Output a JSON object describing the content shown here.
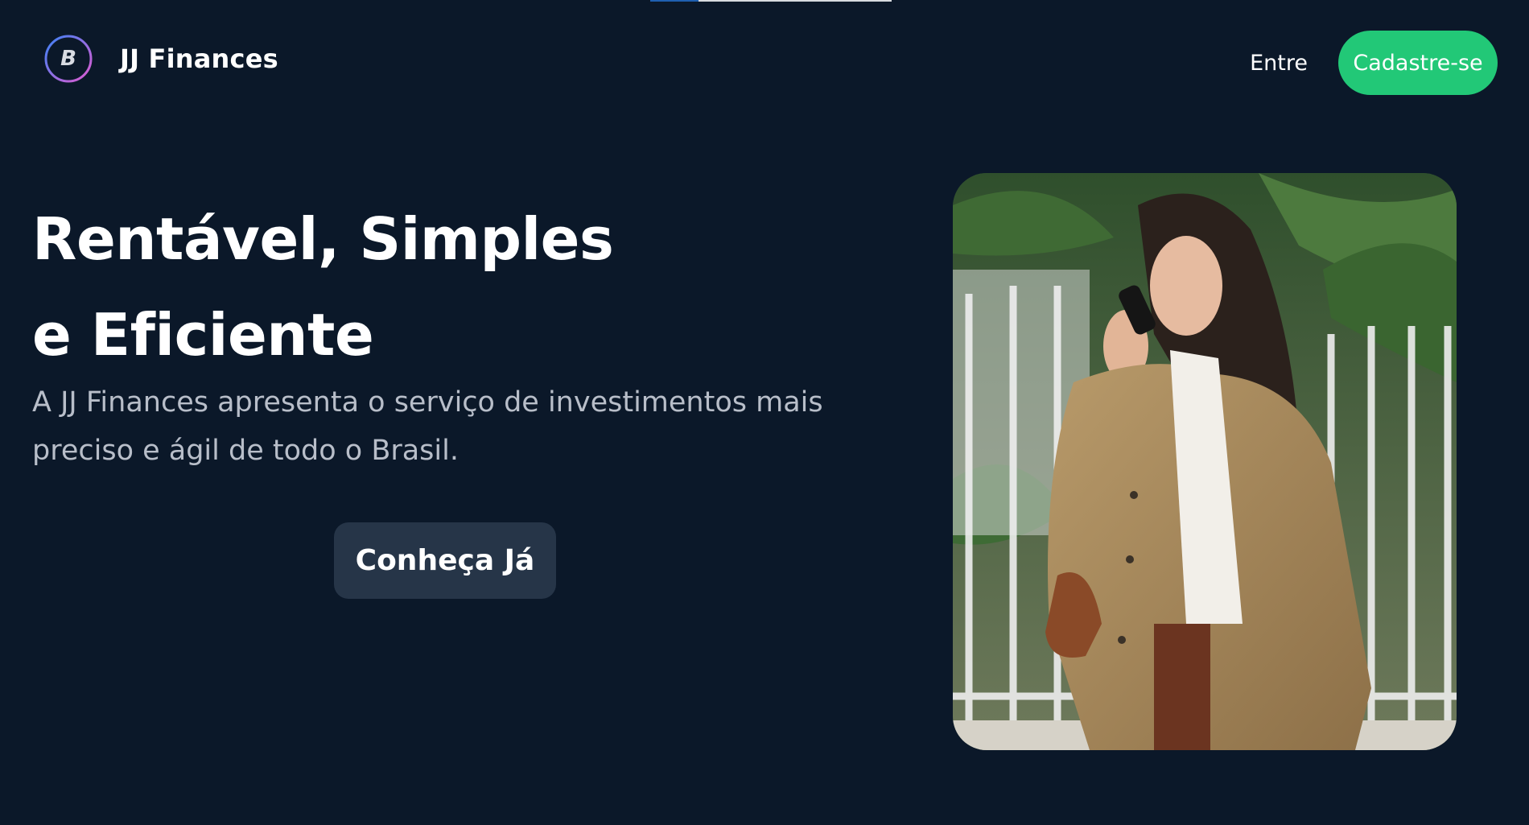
{
  "top_strip": {
    "colors": [
      "#1f5fb0",
      "#d8dbe0"
    ]
  },
  "header": {
    "logo_icon": "bitcoin-icon",
    "logo_glyph": "B",
    "brand": "JJ Finances",
    "login_label": "Entre",
    "signup_label": "Cadastre-se"
  },
  "hero": {
    "title_line1": "Rentável, Simples",
    "title_line2": "e Eficiente",
    "description": "A JJ Finances apresenta o serviço de investimentos mais preciso e ágil de todo o Brasil.",
    "cta_label": "Conheça Já"
  },
  "colors": {
    "background": "#0b1829",
    "accent_green": "#22c877",
    "cta_background": "#263548",
    "logo_ring_start": "#3b82f6",
    "logo_ring_end": "#e05bd0"
  }
}
